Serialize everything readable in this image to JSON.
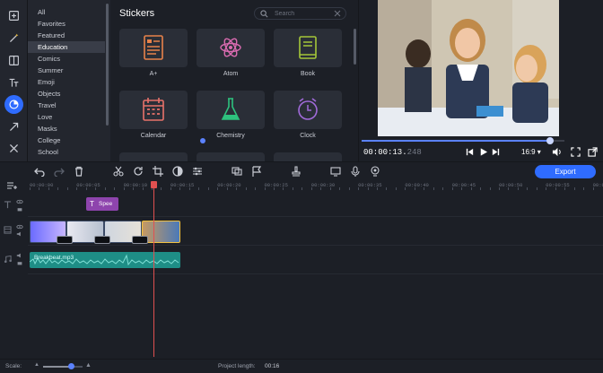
{
  "colors": {
    "accent": "#2f6cff",
    "panel": "#23262e",
    "background": "#1c1f26",
    "playhead": "#e05050",
    "audio": "#1e8e86",
    "title_clip": "#8e44ad"
  },
  "tool_rail": {
    "icons": [
      "import-icon",
      "magic-wand-icon",
      "transitions-icon",
      "titles-icon",
      "stickers-icon",
      "arrow-icon",
      "tools-icon"
    ],
    "active_index": 4
  },
  "categories": {
    "items": [
      "All",
      "Favorites",
      "Featured",
      "Education",
      "Comics",
      "Summer",
      "Emoji",
      "Objects",
      "Travel",
      "Love",
      "Masks",
      "College",
      "School"
    ],
    "selected_index": 3
  },
  "stickers": {
    "title": "Stickers",
    "search_placeholder": "Search",
    "items": [
      {
        "label": "A+",
        "icon": "grade-a-plus-icon"
      },
      {
        "label": "Atom",
        "icon": "atom-icon"
      },
      {
        "label": "Book",
        "icon": "book-icon"
      },
      {
        "label": "Calendar",
        "icon": "calendar-icon"
      },
      {
        "label": "Chemistry",
        "icon": "flask-icon"
      },
      {
        "label": "Clock",
        "icon": "clock-icon"
      }
    ]
  },
  "preview": {
    "timecode_main": "00:00:13.",
    "timecode_frac": "248",
    "aspect": "16:9 ▾",
    "progress": 0.93
  },
  "toolbar": {
    "export_label": "Export"
  },
  "timeline": {
    "ruler": [
      "00:00:00",
      "00:00:05",
      "00:00:10",
      "00:00:15",
      "00:00:20",
      "00:00:25",
      "00:00:30",
      "00:00:35",
      "00:00:40",
      "00:00:45",
      "00:00:50",
      "00:00:55",
      "00:01:00"
    ],
    "title_clip_text": "Spee",
    "audio_clip_name": "Breakbeat.mp3",
    "playhead_time": "00:00:13"
  },
  "status": {
    "scale_label": "Scale:",
    "scale_value": 0.7,
    "project_length_label": "Project length:",
    "project_length_value": "00:16"
  }
}
